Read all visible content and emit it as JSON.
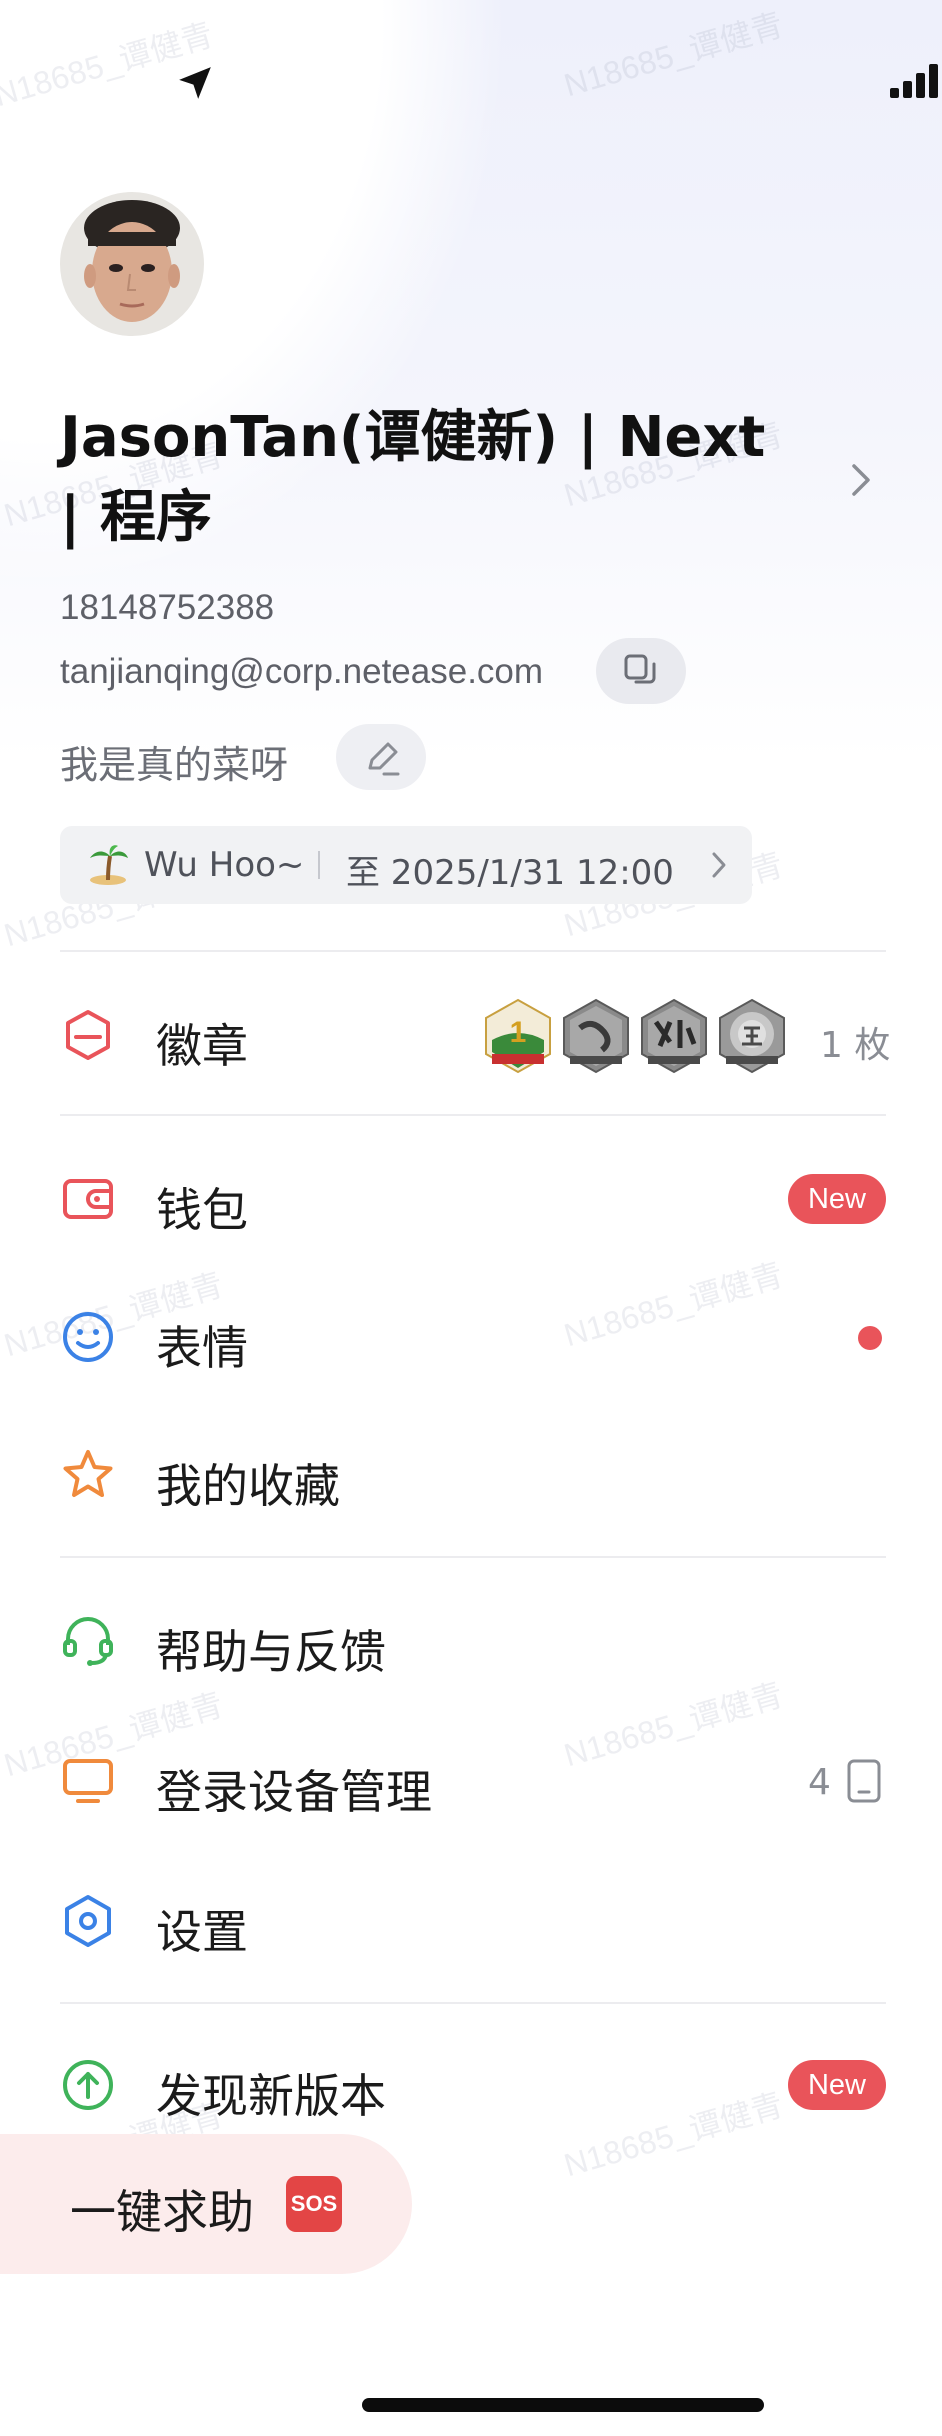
{
  "watermark": "N18685_谭健青",
  "profile": {
    "name": "JasonTan(谭健新) | Next | 程序",
    "phone": "18148752388",
    "email": "tanjianqing@corp.netease.com",
    "signature": "我是真的菜呀"
  },
  "status": {
    "text": "Wu Hoo~",
    "until": "至 2025/1/31 12:00"
  },
  "menu": {
    "badges": {
      "label": "徽章",
      "count": "1 枚",
      "icons": [
        "badge-1-icon",
        "badge-passion-icon",
        "badge-innovation-icon",
        "badge-integrity-icon"
      ]
    },
    "wallet": {
      "label": "钱包",
      "badge": "New"
    },
    "emoji": {
      "label": "表情"
    },
    "favorites": {
      "label": "我的收藏"
    },
    "help": {
      "label": "帮助与反馈"
    },
    "devices": {
      "label": "登录设备管理",
      "count": "4"
    },
    "settings": {
      "label": "设置"
    },
    "update": {
      "label": "发现新版本",
      "badge": "New"
    }
  },
  "sos": {
    "label": "一键求助",
    "tag": "SOS"
  },
  "colors": {
    "accent_red": "#e9545a",
    "wallet_red": "#e9545a",
    "emoji_blue": "#3b82e6",
    "star_orange": "#f08a3c",
    "help_green": "#3fb35a",
    "device_orange": "#f08a3c",
    "settings_blue": "#3b82e6",
    "update_green": "#3fb35a"
  }
}
